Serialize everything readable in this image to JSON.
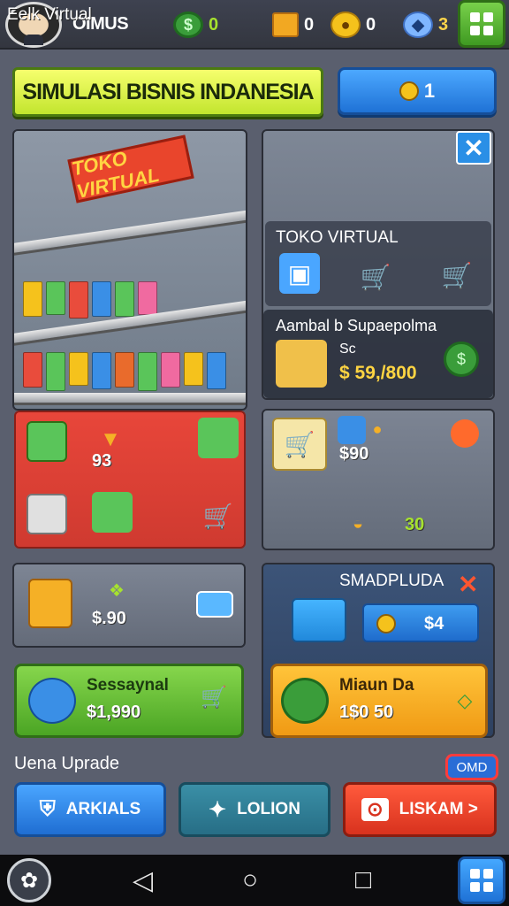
{
  "topbar": {
    "player_name": "OIMUS",
    "resources": [
      {
        "icon": "cash-icon",
        "value": "0"
      },
      {
        "icon": "box-icon",
        "value": "0"
      },
      {
        "icon": "coin-stack-icon",
        "value": "0"
      },
      {
        "icon": "gem-icon",
        "value": "3"
      }
    ]
  },
  "header": {
    "title": "SIMULASI BISNIS INDANESIA",
    "level_value": "1"
  },
  "store": {
    "label": "Eelk Virtual",
    "sign": "TOKO VIRTUAL"
  },
  "virtual_panel": {
    "title": "TOKO VIRTUAL",
    "ambil_title": "Aambal b Supaepolma",
    "ambil_sub": "Sc",
    "ambil_price": "$ 59,/800"
  },
  "red_panel": {
    "value": "93"
  },
  "grey_panel": {
    "price": "$90",
    "count": "30"
  },
  "mid_left": {
    "price": "$.90"
  },
  "mid_right": {
    "title": "SMADPLUDA",
    "bar_value": "$4"
  },
  "cards": {
    "green_title": "Sessaynal",
    "green_value": "$1,990",
    "orange_title": "Miaun Da",
    "orange_value": "1$0 50"
  },
  "upgrade": {
    "label": "Uena Uprade",
    "more": "OMD",
    "btn_blue": "ARKIALS",
    "btn_teal": "LOLION",
    "btn_red": "LISKAM >"
  },
  "colors": {
    "accent_green": "#78d04a",
    "accent_blue": "#2a8fe6",
    "accent_red": "#e8463a",
    "accent_orange": "#f5b026"
  }
}
